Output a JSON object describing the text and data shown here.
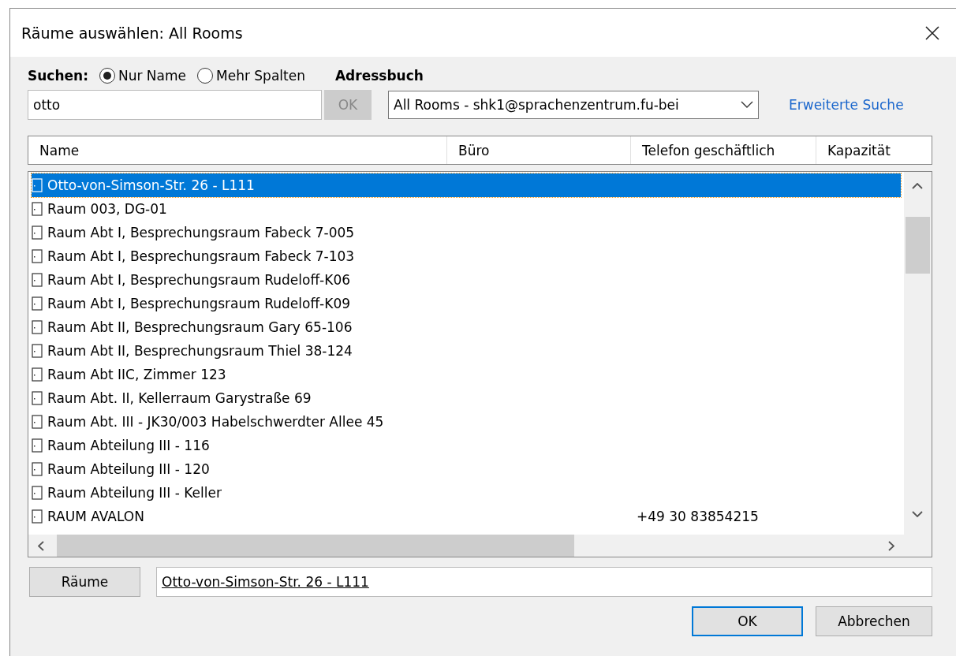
{
  "window": {
    "title": "Räume auswählen: All Rooms"
  },
  "search": {
    "label": "Suchen:",
    "options": [
      {
        "label": "Nur Name",
        "selected": true
      },
      {
        "label": "Mehr Spalten",
        "selected": false
      }
    ],
    "value": "otto",
    "ok_button": "OK",
    "ok_disabled": true
  },
  "address_book": {
    "label": "Adressbuch",
    "value": "All Rooms - shk1@sprachenzentrum.fu-bei",
    "advanced_link": "Erweiterte Suche"
  },
  "table": {
    "columns": [
      "Name",
      "Büro",
      "Telefon geschäftlich",
      "Kapazität"
    ],
    "rows": [
      {
        "name": "Otto-von-Simson-Str. 26 - L111",
        "selected": true
      },
      {
        "name": "Raum 003, DG-01",
        "selected": false
      },
      {
        "name": "Raum Abt I, Besprechungsraum Fabeck 7-005",
        "selected": false
      },
      {
        "name": "Raum Abt I, Besprechungsraum Fabeck 7-103",
        "selected": false
      },
      {
        "name": "Raum Abt I, Besprechungsraum Rudeloff-K06",
        "selected": false
      },
      {
        "name": "Raum Abt I, Besprechungsraum Rudeloff-K09",
        "selected": false
      },
      {
        "name": "Raum Abt II, Besprechungsraum Gary 65-106",
        "selected": false
      },
      {
        "name": "Raum Abt II, Besprechungsraum Thiel 38-124",
        "selected": false
      },
      {
        "name": "Raum Abt IIC, Zimmer 123",
        "selected": false
      },
      {
        "name": "Raum Abt. II, Kellerraum Garystraße 69",
        "selected": false
      },
      {
        "name": "Raum Abt. III - JK30/003 Habelschwerdter Allee 45",
        "selected": false
      },
      {
        "name": "Raum Abteilung III - 116",
        "selected": false
      },
      {
        "name": "Raum Abteilung III - 120",
        "selected": false
      },
      {
        "name": "Raum Abteilung III - Keller",
        "selected": false
      },
      {
        "name": "RAUM AVALON",
        "phone": "+49 30 83854215",
        "selected": false
      }
    ]
  },
  "rooms_button": "Räume",
  "rooms_value": "Otto-von-Simson-Str. 26 - L111",
  "buttons": [
    {
      "label": "OK",
      "default": true
    },
    {
      "label": "Abbrechen",
      "default": false
    }
  ]
}
